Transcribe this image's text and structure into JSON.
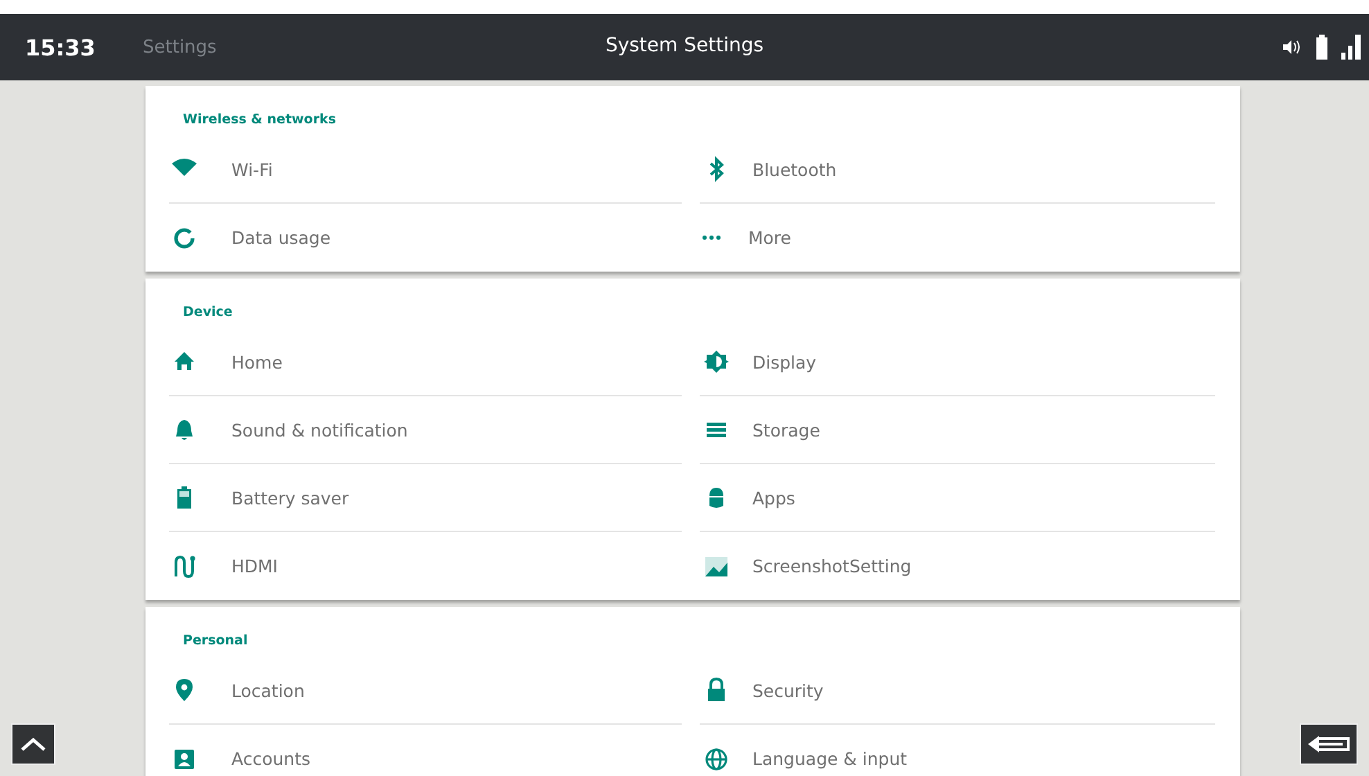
{
  "status_bar": {
    "time": "15:33",
    "app_label": "Settings",
    "title": "System Settings"
  },
  "sections": [
    {
      "title": "Wireless & networks",
      "items": [
        {
          "label": "Wi-Fi"
        },
        {
          "label": "Bluetooth"
        },
        {
          "label": "Data usage"
        },
        {
          "label": "More"
        }
      ]
    },
    {
      "title": "Device",
      "items": [
        {
          "label": "Home"
        },
        {
          "label": "Display"
        },
        {
          "label": "Sound & notification"
        },
        {
          "label": "Storage"
        },
        {
          "label": "Battery saver"
        },
        {
          "label": "Apps"
        },
        {
          "label": "HDMI"
        },
        {
          "label": "ScreenshotSetting"
        }
      ]
    },
    {
      "title": "Personal",
      "items": [
        {
          "label": "Location"
        },
        {
          "label": "Security"
        },
        {
          "label": "Accounts"
        },
        {
          "label": "Language & input"
        }
      ]
    }
  ]
}
